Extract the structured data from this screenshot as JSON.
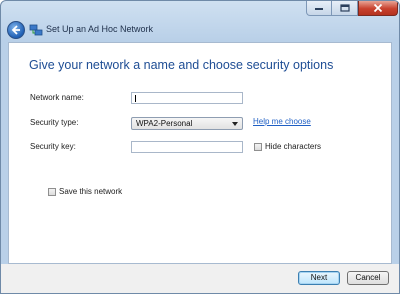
{
  "window": {
    "title": "Set Up an Ad Hoc Network",
    "controls": {
      "minimize_icon": "minimize-icon",
      "maximize_icon": "maximize-icon",
      "close_icon": "close-icon"
    },
    "accent": "#1e4d94"
  },
  "main": {
    "heading": "Give your network a name and choose security options",
    "network_name": {
      "label": "Network name:",
      "value": ""
    },
    "security_type": {
      "label": "Security type:",
      "selected": "WPA2-Personal",
      "help_link": "Help me choose"
    },
    "security_key": {
      "label": "Security key:",
      "value": "",
      "hide_label": "Hide characters",
      "hide_checked": false
    },
    "save_network": {
      "label": "Save this network",
      "checked": false
    }
  },
  "footer": {
    "next_label": "Next",
    "cancel_label": "Cancel"
  }
}
